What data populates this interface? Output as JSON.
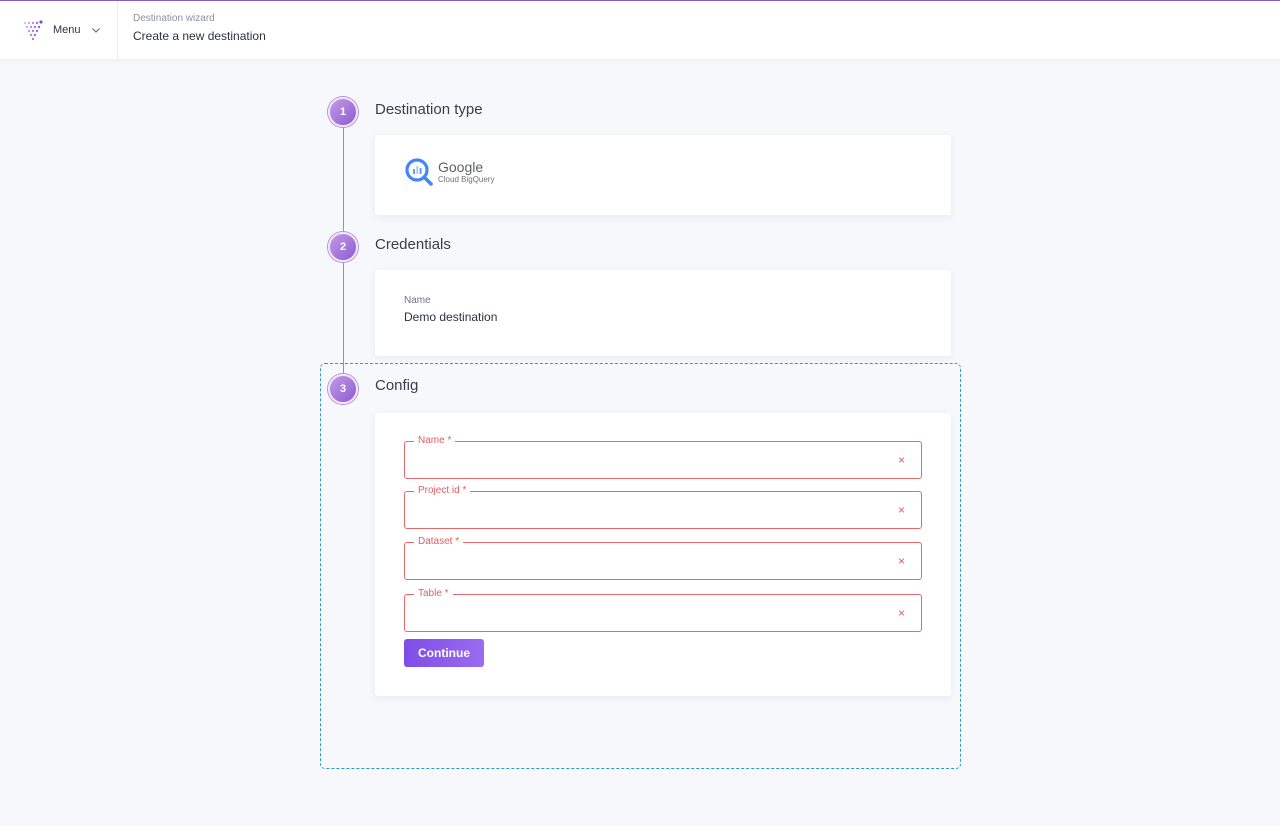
{
  "colors": {
    "accent": "#8e5bd0",
    "error": "#e35d62",
    "focus_outline": "#2a9bc9",
    "button": "#7d4ee6"
  },
  "header": {
    "menu_label": "Menu",
    "menu_icon": "chevron-down-icon",
    "breadcrumb": "Destination wizard",
    "page_title": "Create a new destination"
  },
  "steps": [
    {
      "number": "1",
      "title": "Destination type"
    },
    {
      "number": "2",
      "title": "Credentials"
    },
    {
      "number": "3",
      "title": "Config"
    }
  ],
  "destination_type": {
    "brand": "Google",
    "product": "Cloud BigQuery",
    "icon": "bigquery-logo-icon"
  },
  "credentials": {
    "name_label": "Name",
    "name_value": "Demo destination"
  },
  "config": {
    "fields": [
      {
        "label": "Name *",
        "value": ""
      },
      {
        "label": "Project id *",
        "value": ""
      },
      {
        "label": "Dataset *",
        "value": ""
      },
      {
        "label": "Table *",
        "value": ""
      }
    ],
    "clear_glyph": "×",
    "continue_label": "Continue"
  }
}
